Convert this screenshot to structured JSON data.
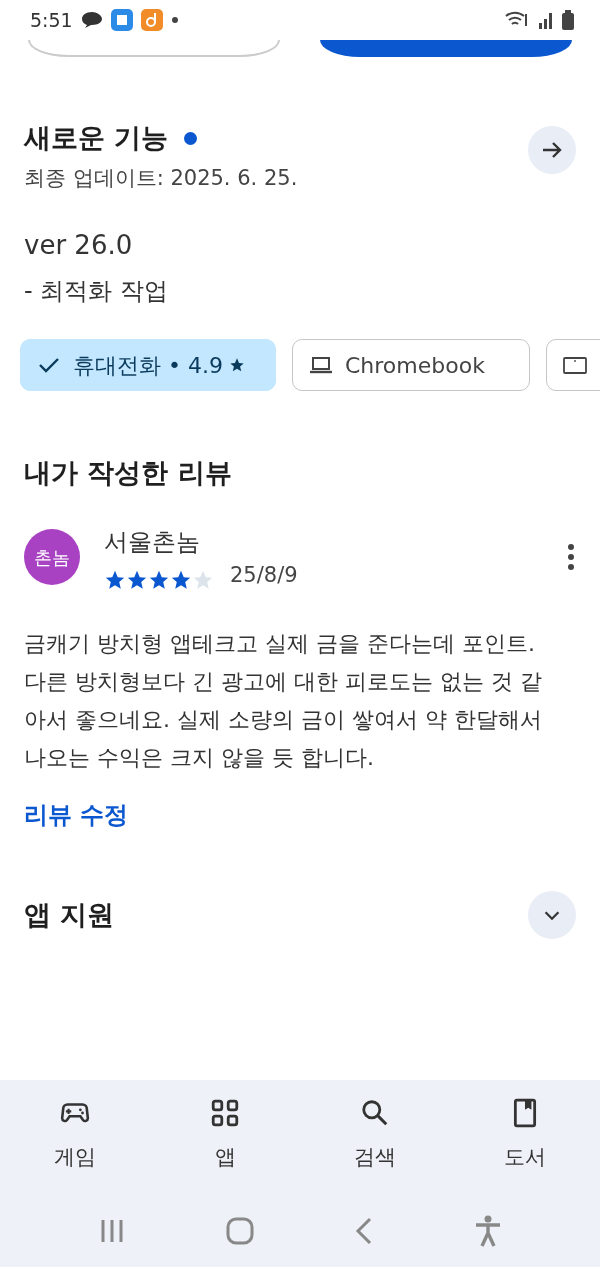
{
  "status_bar": {
    "time": "5:51"
  },
  "whats_new": {
    "title": "새로운 기능",
    "updated": "최종 업데이트: 2025. 6. 25.",
    "version": "ver 26.0",
    "notes": "- 최적화 작업"
  },
  "device_chips": [
    {
      "kind": "phone",
      "label": "휴대전화 • 4.9",
      "selected": true
    },
    {
      "kind": "laptop",
      "label": "Chromebook",
      "selected": false
    },
    {
      "kind": "tablet",
      "selected": false
    }
  ],
  "my_review": {
    "heading": "내가 작성한 리뷰",
    "avatar": "촌놈",
    "author": "서울촌놈",
    "stars": 4,
    "date": "25/8/9",
    "text": "금캐기 방치형 앱테크고 실제 금을 준다는데 포인트. 다른 방치형보다 긴 광고에 대한 피로도는 없는 것 같아서 좋으네요. 실제 소량의 금이 쌓여서 약 한달해서 나오는 수익은 크지 않을 듯 합니다.",
    "edit_link": "리뷰 수정"
  },
  "app_support": {
    "title": "앱 지원",
    "expanded": false
  },
  "bottom_nav": [
    {
      "kind": "games",
      "label": "게임",
      "selected": false
    },
    {
      "kind": "apps",
      "label": "앱",
      "selected": false
    },
    {
      "kind": "search",
      "label": "검색",
      "selected": false
    },
    {
      "kind": "books",
      "label": "도서",
      "selected": false
    }
  ]
}
